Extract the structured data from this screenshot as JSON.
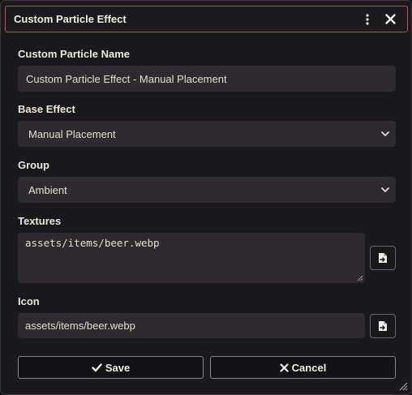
{
  "window": {
    "title": "Custom Particle Effect",
    "menu_icon": "kebab-menu-icon",
    "close_icon": "close-icon"
  },
  "form": {
    "name": {
      "label": "Custom Particle Name",
      "value": "Custom Particle Effect - Manual Placement"
    },
    "base_effect": {
      "label": "Base Effect",
      "value": "Manual Placement"
    },
    "group": {
      "label": "Group",
      "value": "Ambient"
    },
    "textures": {
      "label": "Textures",
      "value": "assets/items/beer.webp",
      "button_icon": "file-import-icon"
    },
    "icon": {
      "label": "Icon",
      "value": "assets/items/beer.webp",
      "button_icon": "file-import-icon"
    }
  },
  "buttons": {
    "save": {
      "label": "Save",
      "icon": "check-icon"
    },
    "cancel": {
      "label": "Cancel",
      "icon": "x-icon"
    }
  },
  "colors": {
    "window_bg": "#1a181d",
    "field_bg": "#2e2a30",
    "title_border": "#c0503a",
    "text": "#e6dccb"
  }
}
